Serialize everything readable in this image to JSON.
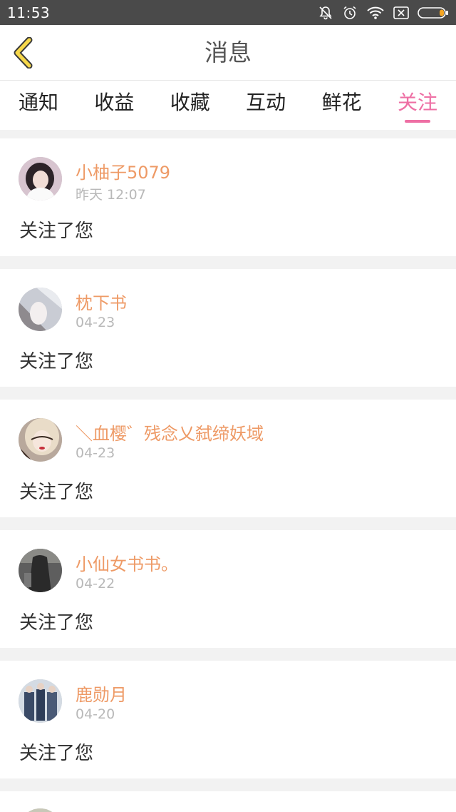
{
  "status_bar": {
    "time": "11:53",
    "icons": [
      "bell-muted-icon",
      "alarm-icon",
      "wifi-icon",
      "sim-error-icon",
      "battery-icon"
    ],
    "battery_color": "#f5a623"
  },
  "header": {
    "title": "消息",
    "back_icon": "chevron-left-icon",
    "accent": "#f7d84a"
  },
  "tabs": [
    {
      "label": "通知",
      "active": false
    },
    {
      "label": "收益",
      "active": false
    },
    {
      "label": "收藏",
      "active": false
    },
    {
      "label": "互动",
      "active": false
    },
    {
      "label": "鲜花",
      "active": false
    },
    {
      "label": "关注",
      "active": true
    }
  ],
  "colors": {
    "accent": "#ee6fa4",
    "username": "#ee9a66",
    "time": "#b8b8b8"
  },
  "messages": [
    {
      "username": "小柚子5079",
      "time": "昨天 12:07",
      "text": "关注了您"
    },
    {
      "username": "枕下书",
      "time": "04-23",
      "text": "关注了您"
    },
    {
      "username": "＼血樱゛残念乂弑缔妖域",
      "time": "04-23",
      "text": "关注了您"
    },
    {
      "username": "小仙女书书。",
      "time": "04-22",
      "text": "关注了您"
    },
    {
      "username": "鹿勋月",
      "time": "04-20",
      "text": "关注了您"
    }
  ]
}
